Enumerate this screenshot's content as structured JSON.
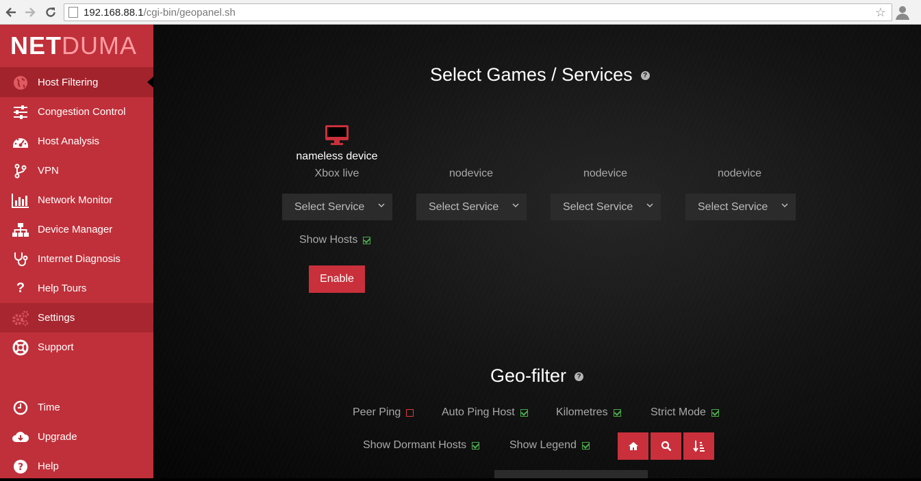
{
  "browser": {
    "url_host": "192.168.88.1",
    "url_path": "/cgi-bin/geopanel.sh"
  },
  "logo": {
    "part1": "NET",
    "part2": "DUMA"
  },
  "sidebar": {
    "items": [
      {
        "label": "Host Filtering",
        "icon": "globe-icon"
      },
      {
        "label": "Congestion Control",
        "icon": "sliders-icon"
      },
      {
        "label": "Host Analysis",
        "icon": "dashboard-icon"
      },
      {
        "label": "VPN",
        "icon": "branch-icon"
      },
      {
        "label": "Network Monitor",
        "icon": "bar-chart-icon"
      },
      {
        "label": "Device Manager",
        "icon": "sitemap-icon"
      },
      {
        "label": "Internet Diagnosis",
        "icon": "stethoscope-icon"
      },
      {
        "label": "Help Tours",
        "icon": "question-icon"
      },
      {
        "label": "Settings",
        "icon": "gears-icon"
      },
      {
        "label": "Support",
        "icon": "lifebuoy-icon"
      }
    ],
    "bottom_items": [
      {
        "label": "Time",
        "icon": "clock-icon"
      },
      {
        "label": "Upgrade",
        "icon": "cloud-download-icon"
      },
      {
        "label": "Help",
        "icon": "help-circle-icon"
      }
    ]
  },
  "games": {
    "title": "Select Games / Services",
    "devices": [
      {
        "name": "nameless device",
        "sub": "Xbox live"
      },
      {
        "name": "",
        "sub": "nodevice"
      },
      {
        "name": "",
        "sub": "nodevice"
      },
      {
        "name": "",
        "sub": "nodevice"
      }
    ],
    "select_placeholder": "Select Service",
    "show_hosts_label": "Show Hosts",
    "enable_label": "Enable"
  },
  "geo": {
    "title": "Geo-filter",
    "options_row1": [
      {
        "label": "Peer Ping",
        "checked": false
      },
      {
        "label": "Auto Ping Host",
        "checked": true
      },
      {
        "label": "Kilometres",
        "checked": true
      },
      {
        "label": "Strict Mode",
        "checked": true
      }
    ],
    "options_row2": [
      {
        "label": "Show Dormant Hosts",
        "checked": true
      },
      {
        "label": "Show Legend",
        "checked": true
      }
    ]
  },
  "colors": {
    "accent": "#c9303b",
    "sidebar": "#c0303a",
    "check_green": "#4cae4c"
  }
}
